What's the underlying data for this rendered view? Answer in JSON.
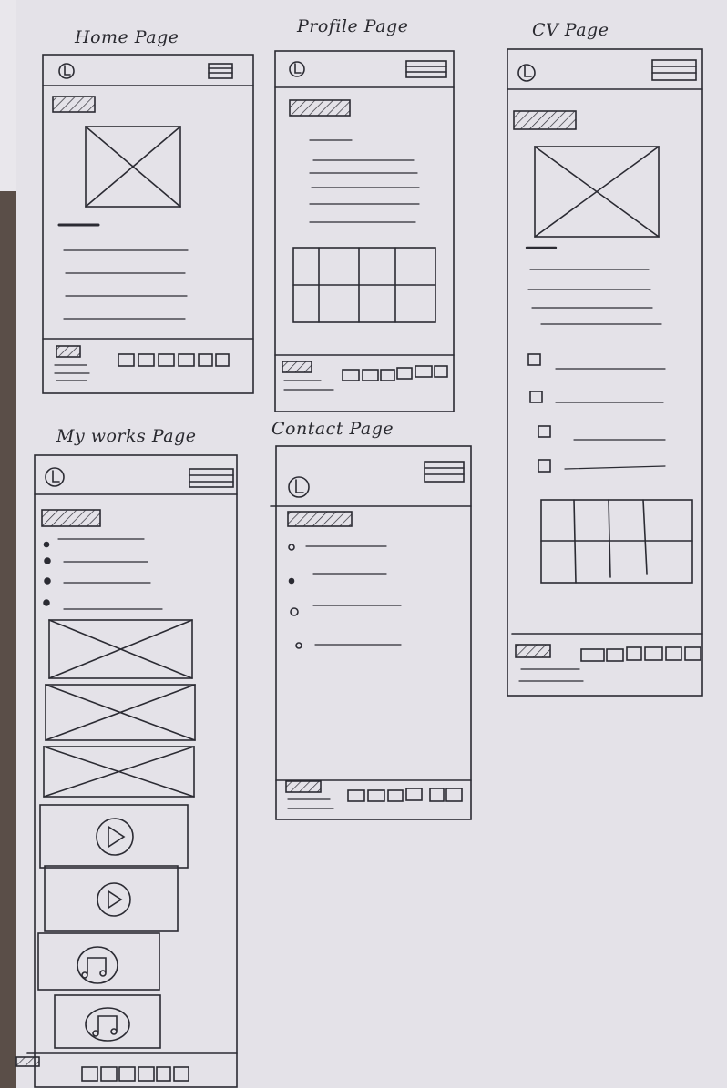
{
  "sheet": {
    "pages": [
      {
        "title": "Home Page"
      },
      {
        "title": "Profile Page"
      },
      {
        "title": "CV Page"
      },
      {
        "title": "My works Page"
      },
      {
        "title": "Contact Page"
      }
    ]
  },
  "colors": {
    "ink": "#2b2b33",
    "paper": "#e4e2e8",
    "background": "#5a4e48"
  }
}
